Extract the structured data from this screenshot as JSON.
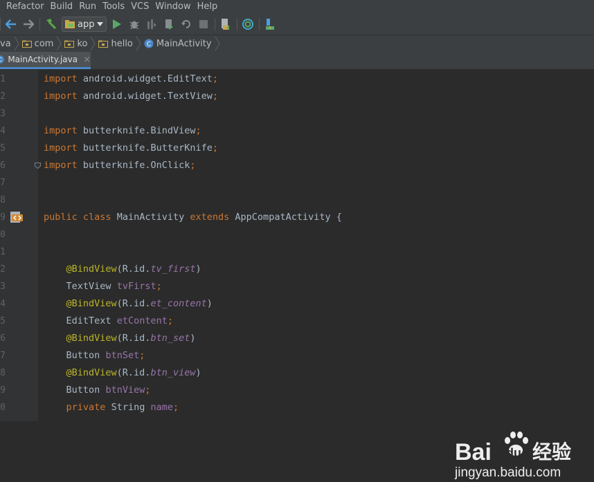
{
  "menu": [
    "Refactor",
    "Build",
    "Run",
    "Tools",
    "VCS",
    "Window",
    "Help"
  ],
  "toolbar": {
    "run_config": "app",
    "icons": [
      "back-icon",
      "forward-icon",
      "build-hammer-icon",
      "run-config-dropdown",
      "run-icon",
      "debug-icon",
      "coverage-icon",
      "profile-icon",
      "apply-changes-icon",
      "stop-icon",
      "sdk-manager-icon",
      "sync-icon",
      "device-icon"
    ]
  },
  "breadcrumb": [
    "va",
    "com",
    "ko",
    "hello",
    "MainActivity"
  ],
  "tab": {
    "label": "MainActivity.java",
    "close": "×"
  },
  "editor": {
    "line_numbers": [
      "1",
      "2",
      "3",
      "4",
      "5",
      "6",
      "7",
      "8",
      "9",
      "0",
      "1",
      "2",
      "3",
      "4",
      "5",
      "6",
      "7",
      "8",
      "9",
      "0"
    ],
    "lines": [
      {
        "k": "import",
        "p": "android.widget.EditText"
      },
      {
        "k": "import",
        "p": "android.widget.TextView"
      },
      {},
      {
        "k": "import",
        "p": "butterknife.BindView"
      },
      {
        "k": "import",
        "p": "butterknife.ButterKnife"
      },
      {
        "k": "import",
        "p": "butterknife.OnClick"
      },
      {},
      {},
      {
        "k": "public class",
        "cls": "MainActivity",
        "ext": "extends",
        "sup": "AppCompatActivity {"
      },
      {},
      {},
      {
        "ann": "@BindView",
        "rid": "(R.id.",
        "id": "tv_first",
        "close": ")"
      },
      {
        "type": "TextView",
        "var": "tvFirst"
      },
      {
        "ann": "@BindView",
        "rid": "(R.id.",
        "id": "et_content",
        "close": ")"
      },
      {
        "type": "EditText",
        "var": "etContent"
      },
      {
        "ann": "@BindView",
        "rid": "(R.id.",
        "id": "btn_set",
        "close": ")"
      },
      {
        "type": "Button",
        "var": "btnSet"
      },
      {
        "ann": "@BindView",
        "rid": "(R.id.",
        "id": "btn_view",
        "close": ")"
      },
      {
        "type": "Button",
        "var": "btnView"
      },
      {
        "k": "private",
        "type": "String",
        "var": "name"
      }
    ],
    "semicolon": ";"
  },
  "watermark": {
    "brand": "Bai",
    "brand2": "du",
    "jingyan": "经验",
    "url": "jingyan.baidu.com"
  },
  "colors": {
    "keyword": "#cc7832",
    "annotation": "#bbb529",
    "field": "#9876aa",
    "text": "#a9b7c6",
    "background": "#2b2b2b"
  }
}
